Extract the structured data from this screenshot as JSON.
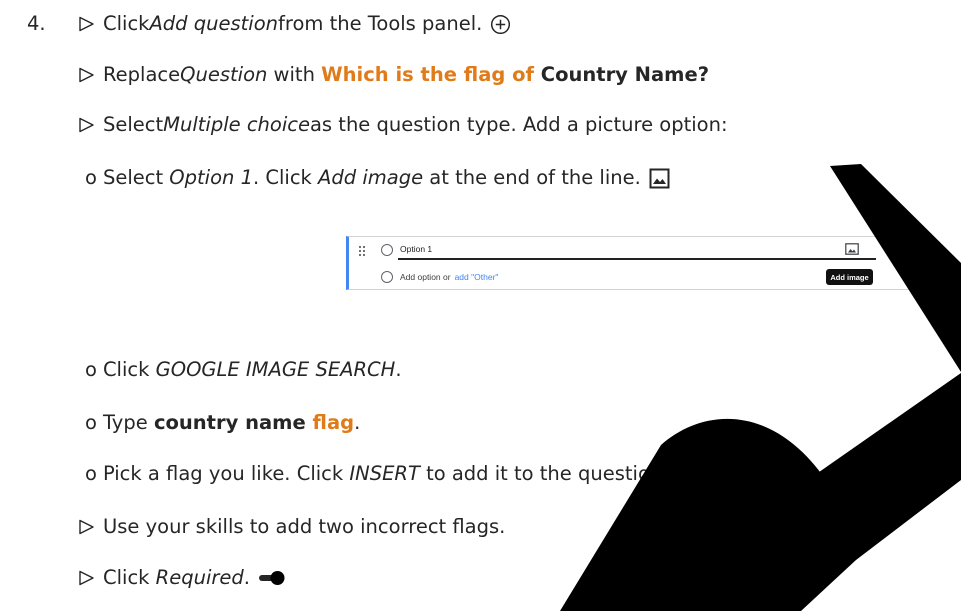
{
  "step_number": "4.",
  "lines": {
    "l1": {
      "pre": "Click ",
      "italic": "Add question",
      "post": " from the Tools panel."
    },
    "l2": {
      "pre": "Replace ",
      "italic": "Question",
      "mid": " with ",
      "orange": "Which is the flag of",
      "bold": " Country Name?"
    },
    "l3": {
      "pre": "Select ",
      "italic": "Multiple choice",
      "post": " as the question type. Add a picture option:"
    },
    "l4": {
      "bullet": "o",
      "pre": "Select ",
      "italic": "Option 1",
      "mid": ". Click ",
      "italic2": "Add image",
      "post": " at the end of the line."
    },
    "l5": {
      "bullet": "o",
      "pre": "Click ",
      "italic": "GOOGLE IMAGE SEARCH",
      "post": "."
    },
    "l6": {
      "bullet": "o",
      "pre": "Type ",
      "bold": "country name ",
      "orange": "flag",
      "post": "."
    },
    "l7": {
      "bullet": "o",
      "pre": "Pick a flag you like. Click ",
      "italic": "INSERT",
      "post": " to add it to the question."
    },
    "l8": {
      "text": "Use your skills to add two incorrect flags."
    },
    "l9": {
      "pre": "Click ",
      "italic": "Required",
      "post": "."
    }
  },
  "screenshot": {
    "option_label": "Option 1",
    "add_option_text": "Add option or",
    "add_other_link": "add \"Other\"",
    "tooltip": "Add image"
  },
  "icons": {
    "add_question": "plus-circle-icon",
    "add_image": "image-icon",
    "required": "toggle-on-icon",
    "step_marker": "triangle-right-icon"
  },
  "colors": {
    "accent_orange": "#e07b1a",
    "text": "#262626",
    "form_blue": "#4285f4"
  }
}
